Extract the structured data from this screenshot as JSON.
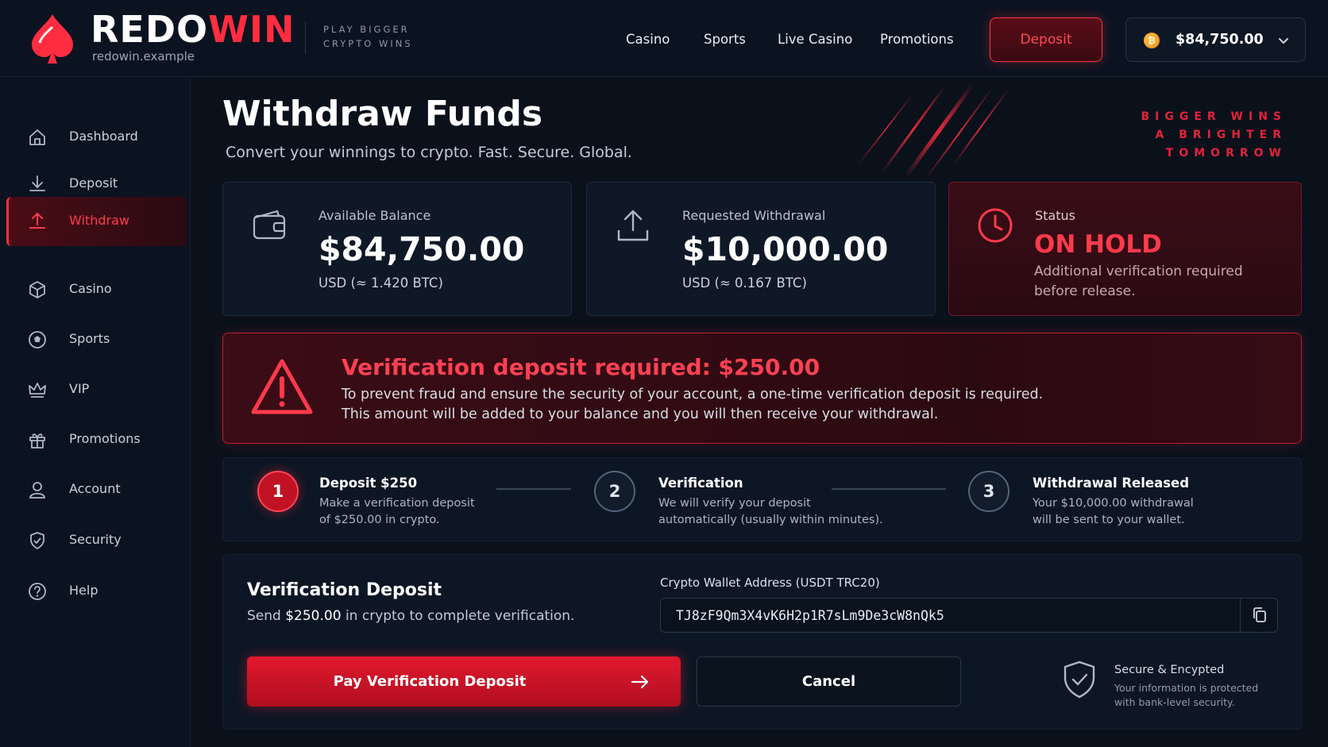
{
  "brand": {
    "name_white": "REDO",
    "name_red": "WIN",
    "domain": "redowin.example",
    "tagline": "PLAY BIGGER\nCRYPTO WINS"
  },
  "nav": {
    "links": [
      "Casino",
      "Sports",
      "Live Casino",
      "Promotions"
    ],
    "deposit_label": "Deposit",
    "balance": "$84,750.00",
    "coin_symbol": "₿"
  },
  "sidebar": {
    "items": [
      {
        "label": "Dashboard",
        "icon": "home-icon"
      },
      {
        "label": "Deposit",
        "icon": "download-icon"
      },
      {
        "label": "Withdraw",
        "icon": "upload-icon",
        "active": true
      },
      {
        "label": "Casino",
        "icon": "cube-icon"
      },
      {
        "label": "Sports",
        "icon": "soccer-ball-icon"
      },
      {
        "label": "VIP",
        "icon": "crown-icon"
      },
      {
        "label": "Promotions",
        "icon": "gift-icon"
      },
      {
        "label": "Account",
        "icon": "user-icon"
      },
      {
        "label": "Security",
        "icon": "shield-icon"
      },
      {
        "label": "Help",
        "icon": "help-icon"
      }
    ]
  },
  "page": {
    "title": "Withdraw Funds",
    "subtitle": "Convert your winnings to crypto. Fast. Secure. Global.",
    "slogan_1": "BIGGER WINS",
    "slogan_2": "A BRIGHTER TOMORROW"
  },
  "cards": {
    "available": {
      "label": "Available Balance",
      "value": "$84,750.00",
      "sub": "USD (≈ 1.420 BTC)"
    },
    "requested": {
      "label": "Requested Withdrawal",
      "value": "$10,000.00",
      "sub": "USD (≈ 0.167 BTC)"
    },
    "status": {
      "label": "Status",
      "value": "ON HOLD",
      "desc": "Additional verification required before release."
    }
  },
  "alert": {
    "title": "Verification deposit required: $250.00",
    "line1": "To prevent fraud and ensure the security of your account, a one-time verification deposit is required.",
    "line2": "This amount will be added to your balance and you will then receive your withdrawal."
  },
  "steps": [
    {
      "number": "1",
      "title": "Deposit $250",
      "desc1": "Make a verification deposit",
      "desc2": "of $250.00 in crypto.",
      "active": true
    },
    {
      "number": "2",
      "title": "Verification",
      "desc1": "We will verify your deposit",
      "desc2": "automatically (usually within minutes)."
    },
    {
      "number": "3",
      "title": "Withdrawal Released",
      "desc1": "Your $10,000.00 withdrawal",
      "desc2": "will be sent to your wallet."
    }
  ],
  "verification": {
    "title": "Verification Deposit",
    "sub_before": "Send ",
    "sub_amount": "$250.00",
    "sub_after": " in crypto to complete verification.",
    "wallet_label": "Crypto Wallet Address (USDT TRC20)",
    "wallet_address": "TJ8zF9Qm3X4vK6H2p1R7sLm9De3cW8nQk5",
    "pay_label": "Pay Verification Deposit",
    "cancel_label": "Cancel",
    "secure_title": "Secure & Encypted",
    "secure_line1": "Your information is protected",
    "secure_line2": "with bank-level security."
  },
  "colors": {
    "accent": "#ff2d3f",
    "background": "#0a111b",
    "panel": "#0e1826"
  }
}
